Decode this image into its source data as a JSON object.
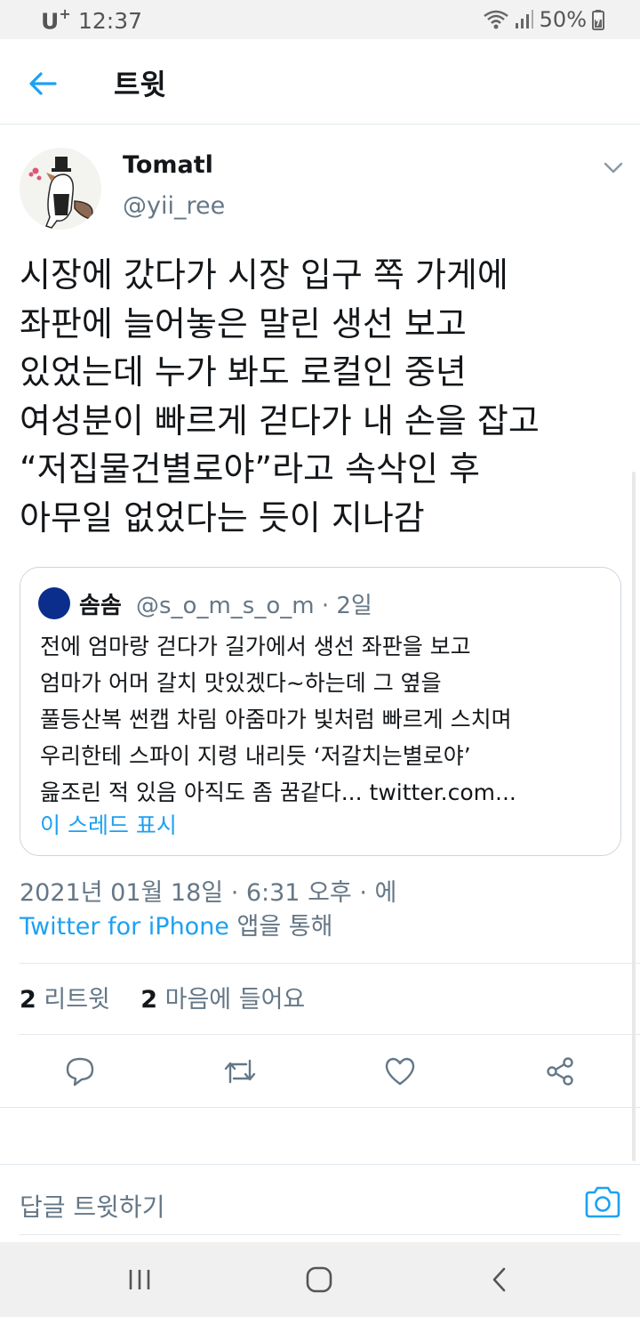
{
  "status_bar": {
    "carrier": "U",
    "carrier_plus": "+",
    "time": "12:37",
    "battery": "50%"
  },
  "header": {
    "title": "트윗"
  },
  "tweet": {
    "name": "Tomatl",
    "handle": "@yii_ree",
    "text": "시장에 갔다가 시장 입구 쪽 가게에\n좌판에 늘어놓은 말린 생선 보고\n있었는데 누가 봐도 로컬인 중년\n여성분이 빠르게 걷다가 내 손을 잡고\n“저집물건별로야”라고 속삭인 후\n아무일 없었다는 듯이 지나감",
    "timestamp": "2021년 01월 18일 · 6:31 오후 · 에",
    "source_link": "Twitter for iPhone",
    "source_suffix": " 앱을 통해",
    "retweets_count": "2",
    "retweets_label": " 리트윗",
    "likes_count": "2",
    "likes_label": " 마음에 들어요"
  },
  "quoted": {
    "name": "솜솜",
    "meta": "@s_o_m_s_o_m · 2일",
    "text": "전에 엄마랑 걷다가 길가에서 생선 좌판을 보고\n엄마가 어머 갈치 맛있겠다~하는데 그 옆을\n풀등산복 썬캡 차림 아줌마가 빛처럼 빠르게 스치며\n우리한테 스파이 지령 내리듯 ‘저갈치는별로야’\n읊조린 적 있음 아직도 좀 꿈같다... twitter.com...",
    "show_thread": "이 스레드 표시"
  },
  "reply": {
    "placeholder": "답글 트윗하기"
  },
  "colors": {
    "accent": "#1da1f2",
    "secondary_text": "#657786",
    "primary_text": "#14171a",
    "border": "#e1e8ed"
  },
  "icons": [
    "back-arrow-icon",
    "caret-down-icon",
    "reply-icon",
    "retweet-icon",
    "like-icon",
    "share-icon",
    "camera-icon",
    "wifi-icon",
    "signal-icon",
    "battery-icon",
    "recents-icon",
    "home-icon",
    "nav-back-icon"
  ]
}
